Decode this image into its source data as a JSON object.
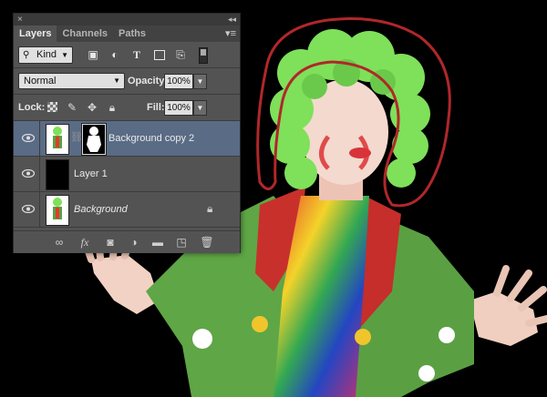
{
  "panel": {
    "titlebar": {
      "close_glyph": "×",
      "collapse_glyph": "◂◂"
    },
    "tabs": [
      {
        "label": "Layers",
        "active": true
      },
      {
        "label": "Channels",
        "active": false
      },
      {
        "label": "Paths",
        "active": false
      }
    ],
    "menu_glyph": "▾≡",
    "filter": {
      "kind_label": "Kind",
      "icons": [
        "image-filter-icon",
        "adjustment-filter-icon",
        "type-filter-icon",
        "shape-filter-icon",
        "smart-object-filter-icon"
      ]
    },
    "blend_mode": "Normal",
    "opacity_label": "Opacity:",
    "opacity_value": "100%",
    "lock_label": "Lock:",
    "fill_label": "Fill:",
    "fill_value": "100%",
    "layers": [
      {
        "name": "Background copy 2",
        "selected": true,
        "visible": true,
        "has_mask": true
      },
      {
        "name": "Layer 1",
        "selected": false,
        "visible": true,
        "has_mask": false
      },
      {
        "name": "Background",
        "selected": false,
        "visible": true,
        "has_mask": false,
        "locked": true
      }
    ],
    "bottom_icons": [
      "link-icon",
      "fx-icon",
      "add-mask-icon",
      "adjustment-layer-icon",
      "group-folder-icon",
      "new-layer-icon",
      "trash-icon"
    ],
    "fx_label": "fx"
  },
  "colors": {
    "panel_bg": "#535353",
    "selected_row": "#5a6b85",
    "selection_outline": "#b0272a"
  }
}
